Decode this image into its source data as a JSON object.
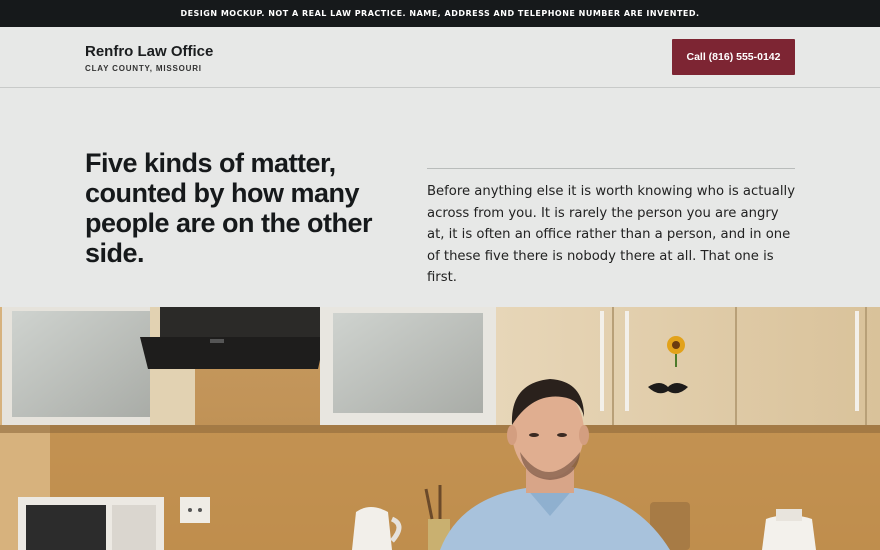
{
  "banner": {
    "text": "DESIGN MOCKUP. NOT A REAL LAW PRACTICE. NAME, ADDRESS AND TELEPHONE NUMBER ARE INVENTED."
  },
  "header": {
    "firm_name": "Renfro Law Office",
    "location": "CLAY COUNTY, MISSOURI",
    "call_label": "Call (816) 555-0142"
  },
  "hero": {
    "headline": "Five kinds of matter, counted by how many people are on the other side.",
    "intro": "Before anything else it is worth knowing who is actually across from you. It is rarely the person you are angry at, it is often an office rather than a person, and in one of these five there is nobody there at all. That one is first."
  },
  "colors": {
    "banner_bg": "#16191b",
    "page_bg": "#e7e8e7",
    "accent": "#7d2533"
  }
}
